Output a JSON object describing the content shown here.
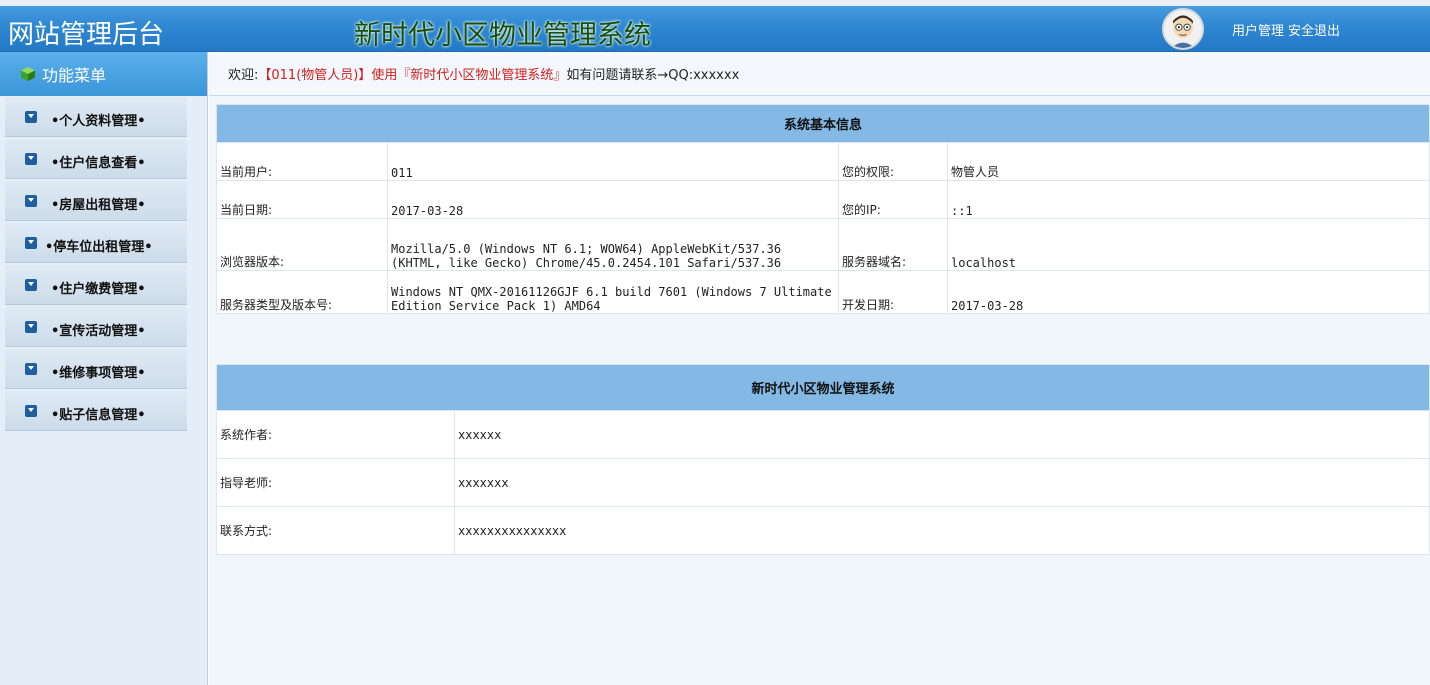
{
  "header": {
    "site_title": "网站管理后台",
    "system_title": "新时代小区物业管理系统",
    "links": [
      "用户管理",
      "安全退出"
    ]
  },
  "sidebar": {
    "title": "功能菜单",
    "items": [
      {
        "label": "•个人资料管理•"
      },
      {
        "label": "•住户信息查看•"
      },
      {
        "label": "•房屋出租管理•"
      },
      {
        "label": "•停车位出租管理•"
      },
      {
        "label": "•住户缴费管理•"
      },
      {
        "label": "•宣传活动管理•"
      },
      {
        "label": "•维修事项管理•"
      },
      {
        "label": "•贴子信息管理•"
      }
    ]
  },
  "welcome": {
    "prefix": "欢迎:",
    "user": "【011(物管人员)】使用『新时代小区物业管理系统』",
    "suffix": "如有问题请联系→QQ:xxxxxx"
  },
  "system_info": {
    "title": "系统基本信息",
    "rows": [
      {
        "label1": "当前用户:",
        "value1": "011",
        "label2": "您的权限:",
        "value2": "物管人员"
      },
      {
        "label1": "当前日期:",
        "value1": "2017-03-28",
        "label2": "您的IP:",
        "value2": "::1"
      },
      {
        "label1": "浏览器版本:",
        "value1": "Mozilla/5.0 (Windows NT 6.1; WOW64) AppleWebKit/537.36 (KHTML, like Gecko) Chrome/45.0.2454.101 Safari/537.36",
        "label2": "服务器域名:",
        "value2": "localhost"
      },
      {
        "label1": "服务器类型及版本号:",
        "value1": "Windows NT QMX-20161126GJF 6.1 build 7601 (Windows 7 Ultimate Edition Service Pack 1) AMD64",
        "label2": "开发日期:",
        "value2": "2017-03-28"
      }
    ]
  },
  "about": {
    "title": "新时代小区物业管理系统",
    "rows": [
      {
        "label": "系统作者:",
        "value": "xxxxxx"
      },
      {
        "label": "指导老师:",
        "value": "xxxxxxx"
      },
      {
        "label": "联系方式:",
        "value": "xxxxxxxxxxxxxxx"
      }
    ]
  },
  "colors": {
    "header_blue": "#2f86d1",
    "table_head": "#84b9e6",
    "highlight_red": "#d41d1d",
    "title_green": "#1a4d0b"
  }
}
